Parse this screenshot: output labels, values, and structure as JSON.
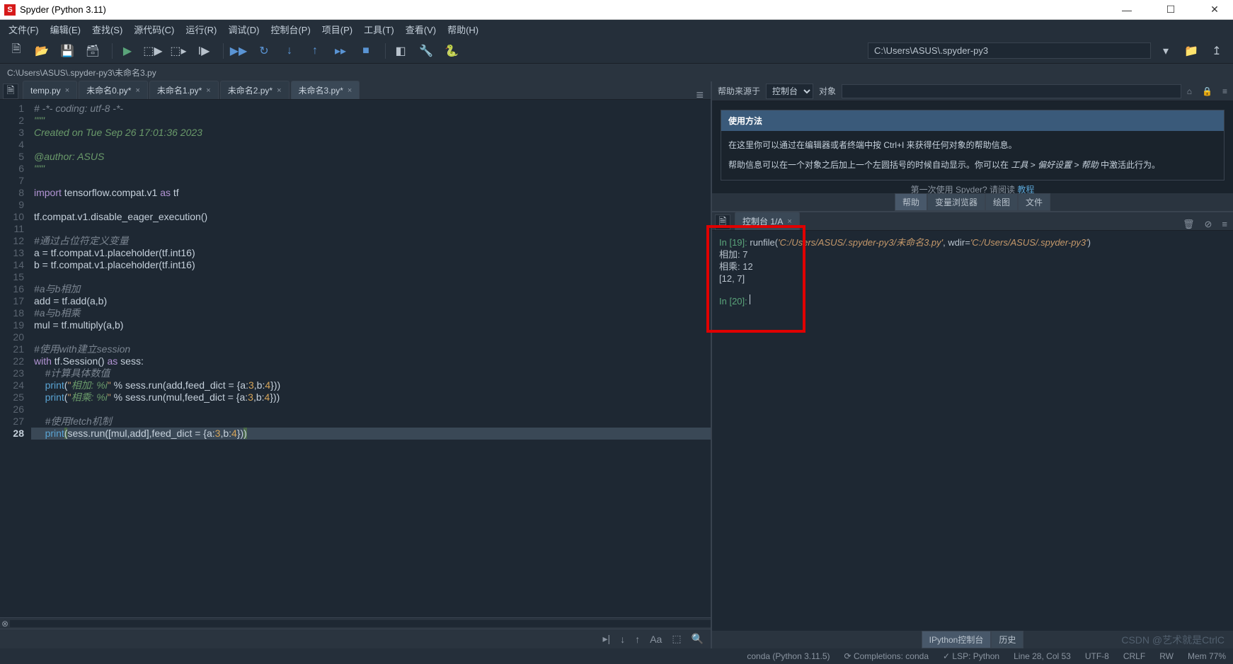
{
  "window": {
    "title": "Spyder (Python 3.11)"
  },
  "menu": [
    "文件(F)",
    "编辑(E)",
    "查找(S)",
    "源代码(C)",
    "运行(R)",
    "调试(D)",
    "控制台(P)",
    "项目(P)",
    "工具(T)",
    "查看(V)",
    "帮助(H)"
  ],
  "path": "C:\\Users\\ASUS\\.spyder-py3",
  "breadcrumb": "C:\\Users\\ASUS\\.spyder-py3\\未命名3.py",
  "tabs": [
    {
      "label": "temp.py",
      "active": false
    },
    {
      "label": "未命名0.py*",
      "active": false
    },
    {
      "label": "未命名1.py*",
      "active": false
    },
    {
      "label": "未命名2.py*",
      "active": false
    },
    {
      "label": "未命名3.py*",
      "active": true
    }
  ],
  "active_line": 28,
  "code_lines": [
    "<span class='c-comment'># -*- coding: utf-8 -*-</span>",
    "<span class='c-docstring'>\"\"\"</span>",
    "<span class='c-docstring'>Created on Tue Sep 26 17:01:36 2023</span>",
    "",
    "<span class='c-docstring'>@author: ASUS</span>",
    "<span class='c-docstring'>\"\"\"</span>",
    "",
    "<span class='c-keyword'>import</span> tensorflow.compat.v1 <span class='c-keyword'>as</span> tf",
    "",
    "tf.compat.v1.disable_eager_execution()",
    "",
    "<span class='c-comment'>#通过占位符定义变量</span>",
    "a = tf.compat.v1.placeholder(tf.int16)",
    "b = tf.compat.v1.placeholder(tf.int16)",
    "",
    "<span class='c-comment'>#a与b相加</span>",
    "add = tf.add(a,b)",
    "<span class='c-comment'>#a与b相乘</span>",
    "mul = tf.multiply(a,b)",
    "",
    "<span class='c-comment'>#使用with建立session</span>",
    "<span class='c-keyword'>with</span> tf.Session() <span class='c-keyword'>as</span> sess:",
    "    <span class='c-comment'>#计算具体数值</span>",
    "    <span class='c-func'>print</span>(<span class='c-string'>\"</span><span class='c-string-it'>相加: %i</span><span class='c-string'>\"</span> % sess.run(add,feed_dict = {a:<span class='c-number'>3</span>,b:<span class='c-number'>4</span>}))",
    "    <span class='c-func'>print</span>(<span class='c-string'>\"</span><span class='c-string-it'>相乘: %i</span><span class='c-string'>\"</span> % sess.run(mul,feed_dict = {a:<span class='c-number'>3</span>,b:<span class='c-number'>4</span>}))",
    "",
    "    <span class='c-comment'>#使用fetch机制</span>",
    "    <span class='c-func'>print</span><span class='c-paren-hl'>(</span>sess.run([mul,add],feed_dict = {a:<span class='c-number'>3</span>,b:<span class='c-number'>4</span>})<span class='c-paren-hl'>)</span>"
  ],
  "help": {
    "source_label": "帮助来源于",
    "source_value": "控制台",
    "object_label": "对象",
    "title": "使用方法",
    "line1": "在这里你可以通过在编辑器或者终端中按 Ctrl+I 来获得任何对象的帮助信息。",
    "line2_a": "帮助信息可以在一个对象之后加上一个左圆括号的时候自动显示。你可以在 ",
    "line2_b": "工具 > 偏好设置 > 帮助",
    "line2_c": " 中激活此行为。",
    "foot_a": "第一次使用 Spyder? 请阅读 ",
    "foot_b": "教程"
  },
  "panel_tabs": [
    "帮助",
    "变量浏览器",
    "绘图",
    "文件"
  ],
  "panel_tabs_active": 0,
  "console_tab": "控制台 1/A",
  "console": {
    "in19_prefix": "In [19]: ",
    "in19_cmd": "runfile(",
    "in19_path1": "'C:/Users/ASUS/.spyder-py3/未命名3.py'",
    "in19_mid": ", wdir=",
    "in19_path2": "'C:/Users/ASUS/.spyder-py3'",
    "in19_end": ")",
    "out1": "相加: 7",
    "out2": "相乘: 12",
    "out3": "[12, 7]",
    "in20": "In [20]: "
  },
  "bottom_tabs": [
    "IPython控制台",
    "历史"
  ],
  "bottom_tabs_active": 0,
  "status": {
    "conda": "conda (Python 3.11.5)",
    "completions": "Completions: conda",
    "lsp": "LSP: Python",
    "pos": "Line 28, Col 53",
    "enc": "UTF-8",
    "eol": "CRLF",
    "rw": "RW",
    "mem": "Mem 77%"
  },
  "watermark": "CSDN @艺术就是CtrlC"
}
